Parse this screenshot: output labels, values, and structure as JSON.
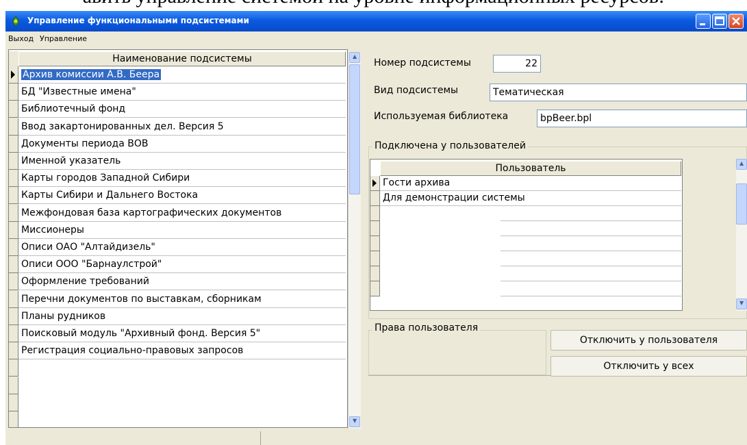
{
  "document": {
    "heading_fragment": "авить управление системой на уровне информационных ресурсов:"
  },
  "window": {
    "title": "Управление функциональными подсистемами"
  },
  "menu": [
    {
      "label": "Выход"
    },
    {
      "label": "Управление"
    }
  ],
  "subsystems": {
    "header": "Наименование подсистемы",
    "rows": [
      "Архив комиссии А.В. Беера",
      "БД \"Известные имена\"",
      "Библиотечный фонд",
      "Ввод закартонированных дел. Версия 5",
      "Документы периода ВОВ",
      "Именной указатель",
      "Карты городов Западной Сибири",
      "Карты Сибири и Дальнего Востока",
      "Межфондовая база картографических документов",
      "Миссионеры",
      "Описи ОАО \"Алтайдизель\"",
      "Описи ООО \"Барнаулстрой\"",
      "Оформление требований",
      "Перечни документов по выставкам, сборникам",
      "Планы рудников",
      "Поисковый модуль \"Архивный фонд. Версия 5\"",
      "Регистрация социально-правовых запросов"
    ],
    "selected_index": 0
  },
  "details": {
    "number_label": "Номер подсистемы",
    "number_value": "22",
    "type_label": "Вид подсистемы",
    "type_value": "Тематическая",
    "library_label": "Используемая библиотека",
    "library_value": "bpBeer.bpl"
  },
  "users_group": {
    "title": "Подключена у пользователей",
    "column": "Пользователь",
    "rows": [
      "Гости архива",
      "Для демонстрации системы"
    ]
  },
  "rights_group": {
    "title": "Права пользователя"
  },
  "buttons": {
    "disconnect_user": "Отключить у пользователя",
    "disconnect_all": "Отключить у всех"
  }
}
